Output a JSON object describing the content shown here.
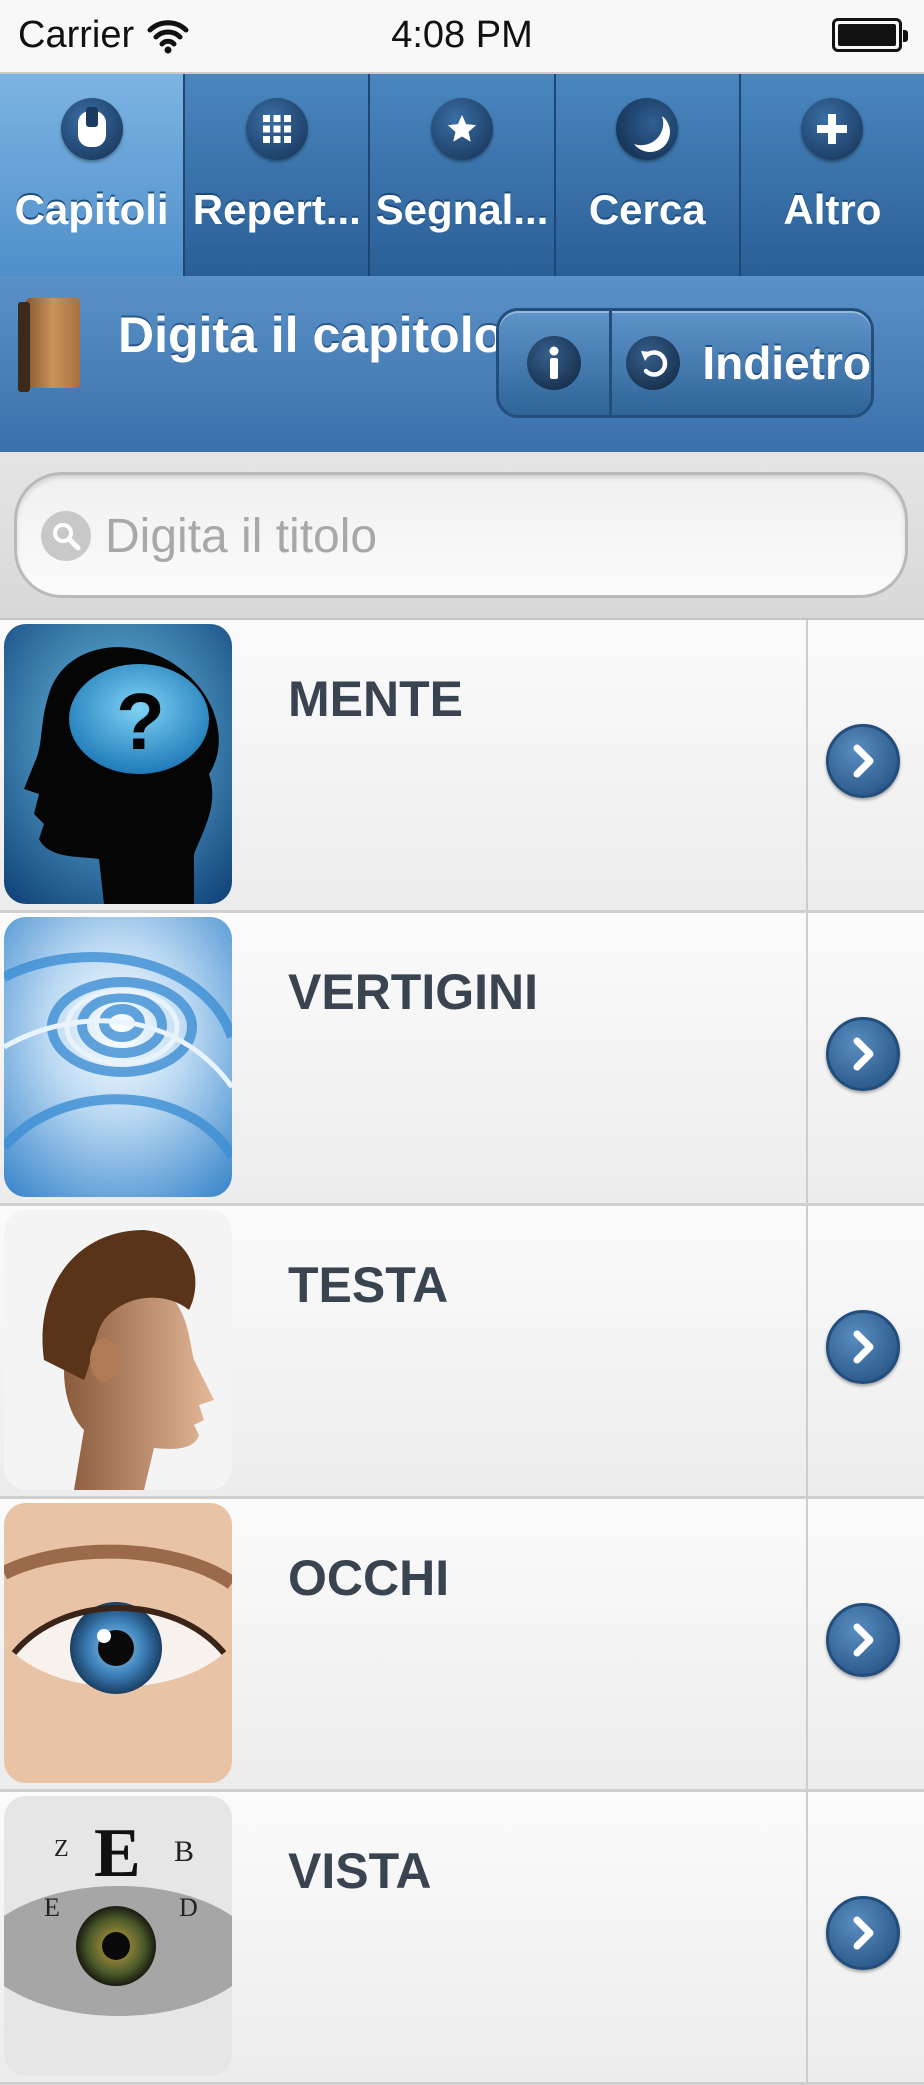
{
  "status_bar": {
    "carrier": "Carrier",
    "time": "4:08 PM"
  },
  "tabs": [
    {
      "label": "Capitoli",
      "icon": "chapters-icon",
      "active": true
    },
    {
      "label": "Repert...",
      "icon": "grid-icon",
      "active": false
    },
    {
      "label": "Segnal...",
      "icon": "star-icon",
      "active": false
    },
    {
      "label": "Cerca",
      "icon": "moon-icon",
      "active": false
    },
    {
      "label": "Altro",
      "icon": "plus-icon",
      "active": false
    }
  ],
  "header": {
    "title": "Digita il capitolo",
    "info_icon": "info-icon",
    "back_label": "Indietro"
  },
  "search": {
    "placeholder": "Digita il titolo",
    "value": ""
  },
  "list": {
    "items": [
      {
        "title": "MENTE",
        "image": "head-question-mark-image"
      },
      {
        "title": "VERTIGINI",
        "image": "blue-spiral-image"
      },
      {
        "title": "TESTA",
        "image": "head-profile-image"
      },
      {
        "title": "OCCHI",
        "image": "eye-image"
      },
      {
        "title": "VISTA",
        "image": "eye-chart-image"
      }
    ]
  },
  "colors": {
    "accent": "#3a71aa",
    "tab_active": "#6aa4d8",
    "title_text": "#3a4450"
  }
}
